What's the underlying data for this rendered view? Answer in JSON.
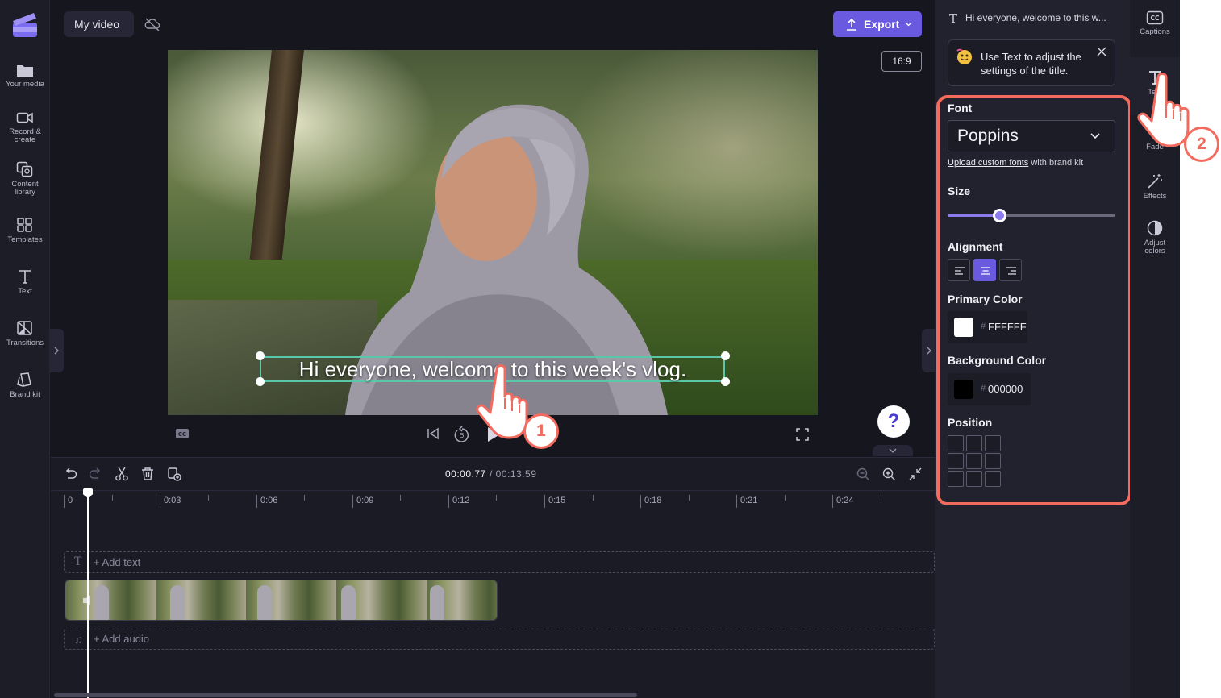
{
  "app": {
    "project_title": "My video"
  },
  "left_rail": [
    {
      "label": "Your media",
      "icon": "folder-icon"
    },
    {
      "label": "Record & create",
      "icon": "camera-icon"
    },
    {
      "label": "Content library",
      "icon": "library-icon"
    },
    {
      "label": "Templates",
      "icon": "templates-icon"
    },
    {
      "label": "Text",
      "icon": "text-icon"
    },
    {
      "label": "Transitions",
      "icon": "transitions-icon"
    },
    {
      "label": "Brand kit",
      "icon": "brand-kit-icon"
    }
  ],
  "toolbar": {
    "export_label": "Export",
    "aspect_ratio": "16:9"
  },
  "preview": {
    "caption": "Hi everyone, welcome to this week's vlog."
  },
  "help": {
    "label": "?"
  },
  "timeline": {
    "current_time": "00:00.77",
    "total_time": "/ 00:13.59",
    "ticks": [
      "0",
      "0:03",
      "0:06",
      "0:09",
      "0:12",
      "0:15",
      "0:18",
      "0:21",
      "0:24"
    ],
    "add_text": "+ Add text",
    "add_audio": "+ Add audio"
  },
  "panel": {
    "title": "Hi everyone, welcome to this w...",
    "tip": "Use Text to adjust the settings of the title.",
    "font_label": "Font",
    "font_value": "Poppins",
    "upload_link": "Upload custom fonts",
    "upload_suffix": " with brand kit",
    "size_label": "Size",
    "size_value": 0.31,
    "alignment_label": "Alignment",
    "alignment_selected": "center",
    "primary_color_label": "Primary Color",
    "primary_color": "FFFFFF",
    "primary_color_hex": "#FFFFFF",
    "background_color_label": "Background Color",
    "background_color": "000000",
    "background_color_hex": "#000000",
    "position_label": "Position"
  },
  "right_rail": [
    {
      "label": "Captions",
      "icon": "captions-icon"
    },
    {
      "label": "Text",
      "icon": "text-icon"
    },
    {
      "label": "Fade",
      "icon": "fade-icon"
    },
    {
      "label": "Effects",
      "icon": "effects-icon"
    },
    {
      "label": "Adjust colors",
      "icon": "adjust-colors-icon"
    }
  ],
  "annotations": {
    "step1": "1",
    "step2": "2"
  },
  "colors": {
    "accent": "#6A5AE0",
    "highlight": "#F26B5E",
    "selection": "#59C7A8"
  }
}
